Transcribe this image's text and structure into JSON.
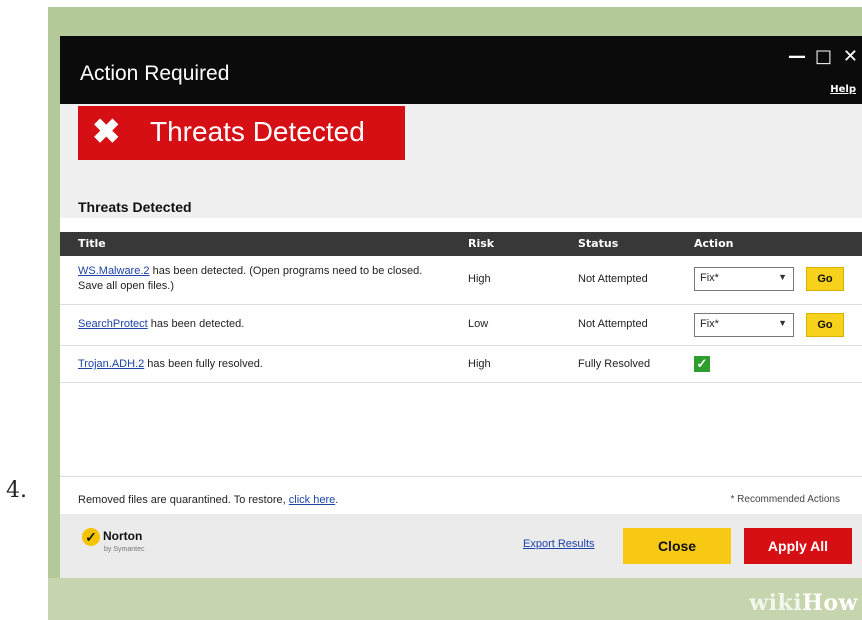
{
  "step_number": "4.",
  "watermark": {
    "wiki": "wiki",
    "how": "How"
  },
  "window": {
    "title": "Action Required",
    "controls": {
      "minimize": "—",
      "maximize": "□",
      "close": "✕"
    },
    "help_link": "Help"
  },
  "banner": {
    "icon": "x-icon",
    "text": "Threats Detected",
    "color": "#d50f14"
  },
  "section_title": "Threats Detected",
  "table": {
    "headers": {
      "title": "Title",
      "risk": "Risk",
      "status": "Status",
      "action": "Action"
    },
    "rows": [
      {
        "threat_name": "WS.Malware.2",
        "message": "has been detected. (Open programs need to be closed. Save all open files.)",
        "risk": "High",
        "status": "Not Attempted",
        "action_select": "Fix*",
        "go_label": "Go"
      },
      {
        "threat_name": "SearchProtect",
        "message": "has been detected.",
        "risk": "Low",
        "status": "Not Attempted",
        "action_select": "Fix*",
        "go_label": "Go"
      },
      {
        "threat_name": "Trojan.ADH.2",
        "message": "has been fully resolved.",
        "risk": "High",
        "status": "Fully Resolved",
        "resolved_icon": "check-icon"
      }
    ]
  },
  "footer": {
    "quarantine_text": "Removed files are quarantined. To restore,",
    "restore_link": "click here",
    "quarantine_suffix": ".",
    "recommended_note": "* Recommended Actions"
  },
  "actions": {
    "brand": "Norton",
    "brand_sub": "by Symantec",
    "export_link": "Export Results",
    "close_label": "Close",
    "apply_all_label": "Apply All"
  },
  "colors": {
    "accent_red": "#d50f14",
    "accent_yellow": "#f7c914",
    "titlebar": "#0b0b0b"
  }
}
